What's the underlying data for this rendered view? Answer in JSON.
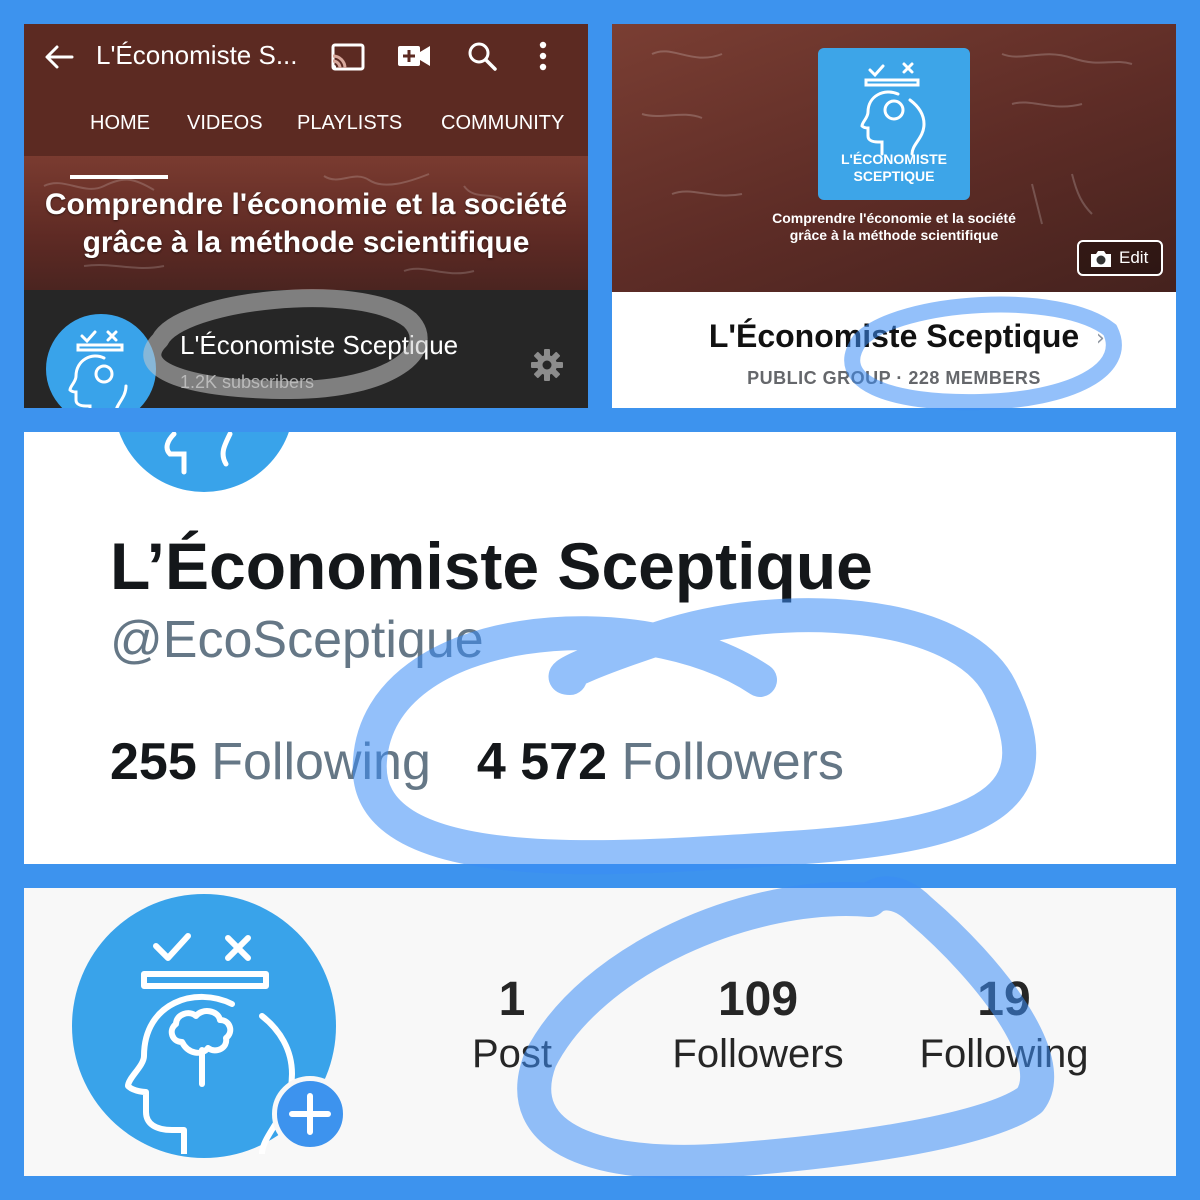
{
  "youtube": {
    "app_title": "L'Économiste S...",
    "tabs": [
      "HOME",
      "VIDEOS",
      "PLAYLISTS",
      "COMMUNITY"
    ],
    "active_tab": "HOME",
    "banner_line1": "Comprendre l'économie et la société",
    "banner_line2": "grâce à la méthode scientifique",
    "channel_name": "L'Économiste Sceptique",
    "subscribers": "1.2K subscribers",
    "icons": [
      "back-arrow-icon",
      "cast-icon",
      "video-camera-add-icon",
      "search-icon",
      "more-vert-icon",
      "gear-icon"
    ]
  },
  "facebook": {
    "logo_line1": "L'ÉCONOMISTE",
    "logo_line2": "SCEPTIQUE",
    "cover_line1": "Comprendre l'économie et la société",
    "cover_line2": "grâce à la méthode scientifique",
    "edit_label": "Edit",
    "group_name": "L'Économiste Sceptique",
    "group_meta": "PUBLIC GROUP · 228 MEMBERS"
  },
  "twitter": {
    "name": "L’Économiste Sceptique",
    "handle": "@EcoSceptique",
    "following_count": "255",
    "following_label": "Following",
    "followers_count": "4 572",
    "followers_label": "Followers"
  },
  "instagram": {
    "posts_count": "1",
    "posts_label": "Post",
    "followers_count": "109",
    "followers_label": "Followers",
    "following_count": "19",
    "following_label": "Following"
  },
  "colors": {
    "frame_blue": "#3d93ee",
    "logo_blue": "#39a3ea",
    "youtube_bar": "#5c2a22",
    "highlighter": "#3b8cf5"
  }
}
